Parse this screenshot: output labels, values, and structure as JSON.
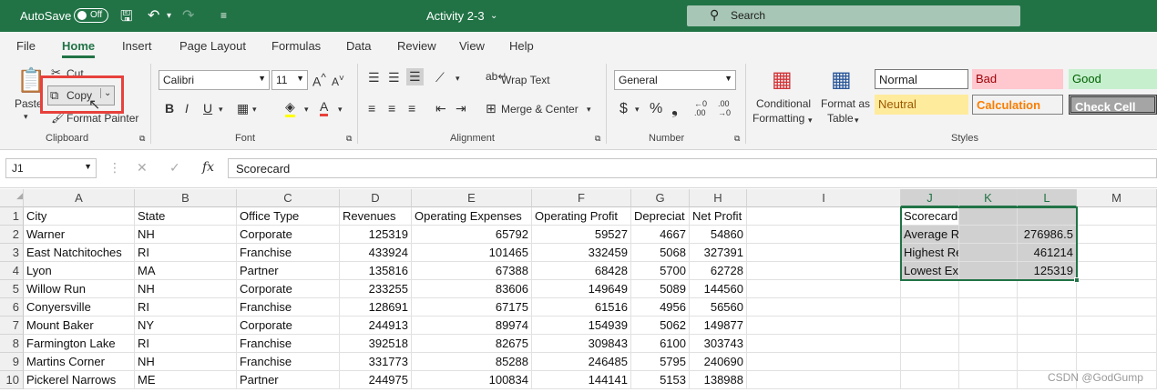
{
  "titlebar": {
    "autosave_label": "AutoSave",
    "autosave_state": "Off",
    "document_title": "Activity 2-3",
    "search_label": "Search"
  },
  "menu_tabs": [
    "File",
    "Home",
    "Insert",
    "Page Layout",
    "Formulas",
    "Data",
    "Review",
    "View",
    "Help"
  ],
  "active_tab": "Home",
  "ribbon": {
    "clipboard": {
      "paste": "Paste",
      "cut": "Cut",
      "copy": "Copy",
      "format_painter": "Format Painter",
      "label": "Clipboard"
    },
    "font": {
      "font_name": "Calibri",
      "font_size": "11",
      "label": "Font"
    },
    "alignment": {
      "wrap_text": "Wrap Text",
      "merge_center": "Merge & Center",
      "label": "Alignment"
    },
    "number": {
      "format": "General",
      "label": "Number"
    },
    "styles": {
      "conditional": [
        "Conditional",
        "Formatting"
      ],
      "format_as_table": [
        "Format as",
        "Table"
      ],
      "normal": "Normal",
      "bad": "Bad",
      "good": "Good",
      "neutral": "Neutral",
      "calculation": "Calculation",
      "check_cell": "Check Cell",
      "label": "Styles"
    }
  },
  "formula_bar": {
    "name_box": "J1",
    "fx": "fx",
    "content": "Scorecard"
  },
  "columns": [
    "A",
    "B",
    "C",
    "D",
    "E",
    "F",
    "G",
    "H",
    "I",
    "J",
    "K",
    "L",
    "M"
  ],
  "rows": [
    "1",
    "2",
    "3",
    "4",
    "5",
    "6",
    "7",
    "8",
    "9",
    "10"
  ],
  "headers": [
    "City",
    "State",
    "Office Type",
    "Revenues",
    "Operating Expenses",
    "Operating Profit",
    "Depreciat",
    "Net Profit"
  ],
  "data_rows": [
    [
      "Warner",
      "NH",
      "Corporate",
      "125319",
      "65792",
      "59527",
      "4667",
      "54860"
    ],
    [
      "East Natchitoches",
      "RI",
      "Franchise",
      "433924",
      "101465",
      "332459",
      "5068",
      "327391"
    ],
    [
      "Lyon",
      "MA",
      "Partner",
      "135816",
      "67388",
      "68428",
      "5700",
      "62728"
    ],
    [
      "Willow Run",
      "NH",
      "Corporate",
      "233255",
      "83606",
      "149649",
      "5089",
      "144560"
    ],
    [
      "Conyersville",
      "RI",
      "Franchise",
      "128691",
      "67175",
      "61516",
      "4956",
      "56560"
    ],
    [
      "Mount Baker",
      "NY",
      "Corporate",
      "244913",
      "89974",
      "154939",
      "5062",
      "149877"
    ],
    [
      "Farmington Lake",
      "RI",
      "Franchise",
      "392518",
      "82675",
      "309843",
      "6100",
      "303743"
    ],
    [
      "Martins Corner",
      "NH",
      "Franchise",
      "331773",
      "85288",
      "246485",
      "5795",
      "240690"
    ],
    [
      "Pickerel Narrows",
      "ME",
      "Partner",
      "244975",
      "100834",
      "144141",
      "5153",
      "138988"
    ]
  ],
  "scorecard": [
    [
      "Scorecard",
      ""
    ],
    [
      "Average Revenue",
      "276986.5"
    ],
    [
      "Highest Revenue",
      "461214"
    ],
    [
      "Lowest Expenses",
      "125319"
    ]
  ],
  "watermark": "CSDN @GodGump",
  "colors": {
    "excel_green": "#217346",
    "highlight_red": "#e8413c"
  }
}
